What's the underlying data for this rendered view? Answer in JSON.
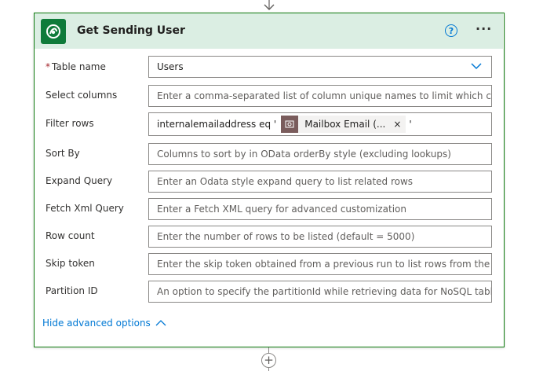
{
  "card": {
    "title": "Get Sending User",
    "help": "?",
    "more": "···"
  },
  "fields": {
    "table_name": {
      "label": "Table name",
      "required_mark": "*",
      "value": "Users"
    },
    "select_columns": {
      "label": "Select columns",
      "placeholder": "Enter a comma-separated list of column unique names to limit which columns are listed"
    },
    "filter_rows": {
      "label": "Filter rows",
      "prefix": "internalemailaddress eq '",
      "token_label": "Mailbox Email (...",
      "token_remove": "×",
      "suffix": "'"
    },
    "sort_by": {
      "label": "Sort By",
      "placeholder": "Columns to sort by in OData orderBy style (excluding lookups)"
    },
    "expand_query": {
      "label": "Expand Query",
      "placeholder": "Enter an Odata style expand query to list related rows"
    },
    "fetch_xml": {
      "label": "Fetch Xml Query",
      "placeholder": "Enter a Fetch XML query for advanced customization"
    },
    "row_count": {
      "label": "Row count",
      "placeholder": "Enter the number of rows to be listed (default = 5000)"
    },
    "skip_token": {
      "label": "Skip token",
      "placeholder": "Enter the skip token obtained from a previous run to list rows from the next page"
    },
    "partition_id": {
      "label": "Partition ID",
      "placeholder": "An option to specify the partitionId while retrieving data for NoSQL tables"
    }
  },
  "advanced": {
    "toggle_label": "Hide advanced options"
  },
  "add_step": "+",
  "colors": {
    "accent": "#107c10",
    "header_bg": "#dbeee3",
    "link": "#0078d4"
  }
}
